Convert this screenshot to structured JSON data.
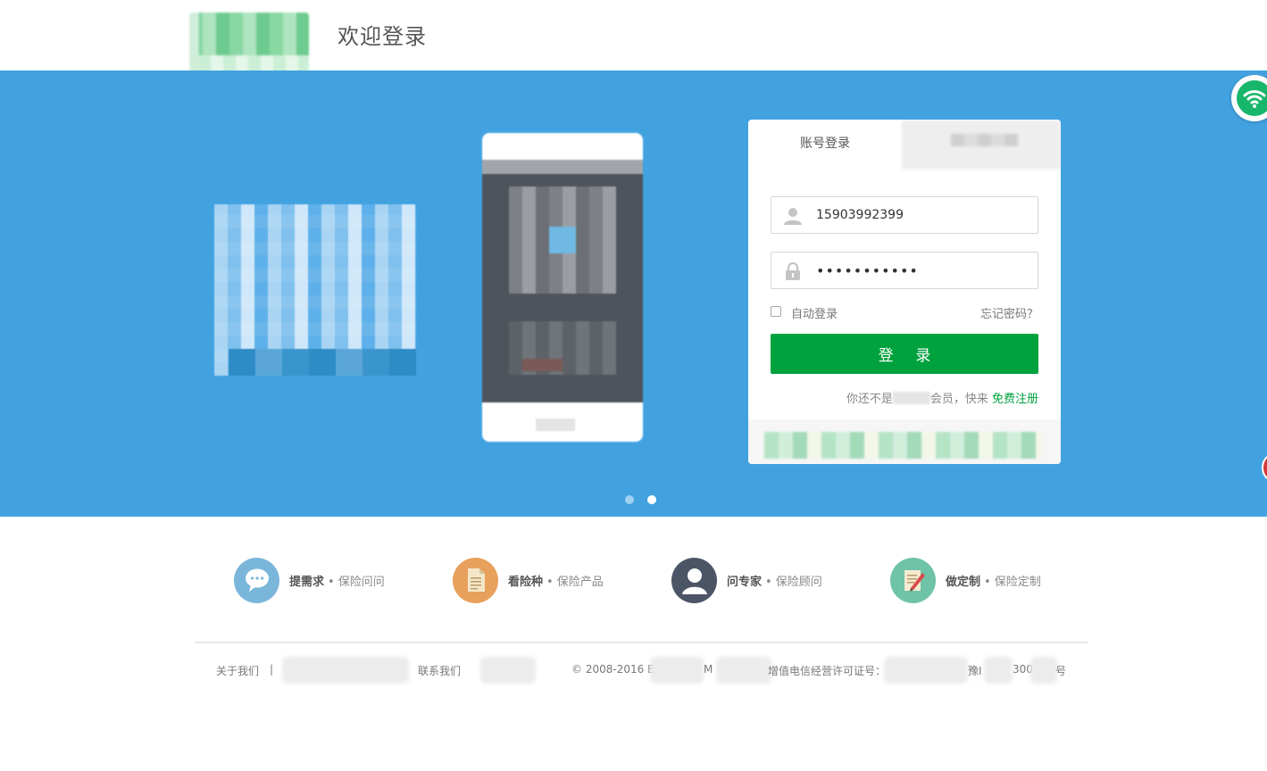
{
  "header": {
    "page_title": "欢迎登录"
  },
  "login": {
    "tab_account": "账号登录",
    "username_value": "15903992399",
    "password_value": "•••••••••••",
    "auto_login_label": "自动登录",
    "forgot_link": "忘记密码？",
    "login_button": "登 录",
    "register_prefix": "你还不是",
    "register_suffix": "会员，快来",
    "register_link": "免费注册"
  },
  "carousel": {
    "active_index": 2,
    "count": 2
  },
  "features": [
    {
      "main": "提需求",
      "sub": "保险问问",
      "icon": "speech-bubble-icon",
      "color": "#7ab6da"
    },
    {
      "main": "看险种",
      "sub": "保险产品",
      "icon": "document-icon",
      "color": "#e8a05d"
    },
    {
      "main": "问专家",
      "sub": "保险顾问",
      "icon": "person-icon",
      "color": "#4c5566"
    },
    {
      "main": "做定制",
      "sub": "保险定制",
      "icon": "edit-note-icon",
      "color": "#6fc3a6"
    }
  ],
  "footer": {
    "about": "关于我们",
    "separator": "|",
    "contact": "联系我们",
    "copyright": "© 2008-2016 B",
    "copyright_m": "M",
    "license_label": "增值电信经营许可证号：",
    "license_prefix": "豫I",
    "license_mid": "300",
    "license_suffix": "号"
  },
  "colors": {
    "banner_bg": "#42a2e0",
    "primary_green": "#00a23e",
    "wifi_badge": "#17b66a"
  }
}
